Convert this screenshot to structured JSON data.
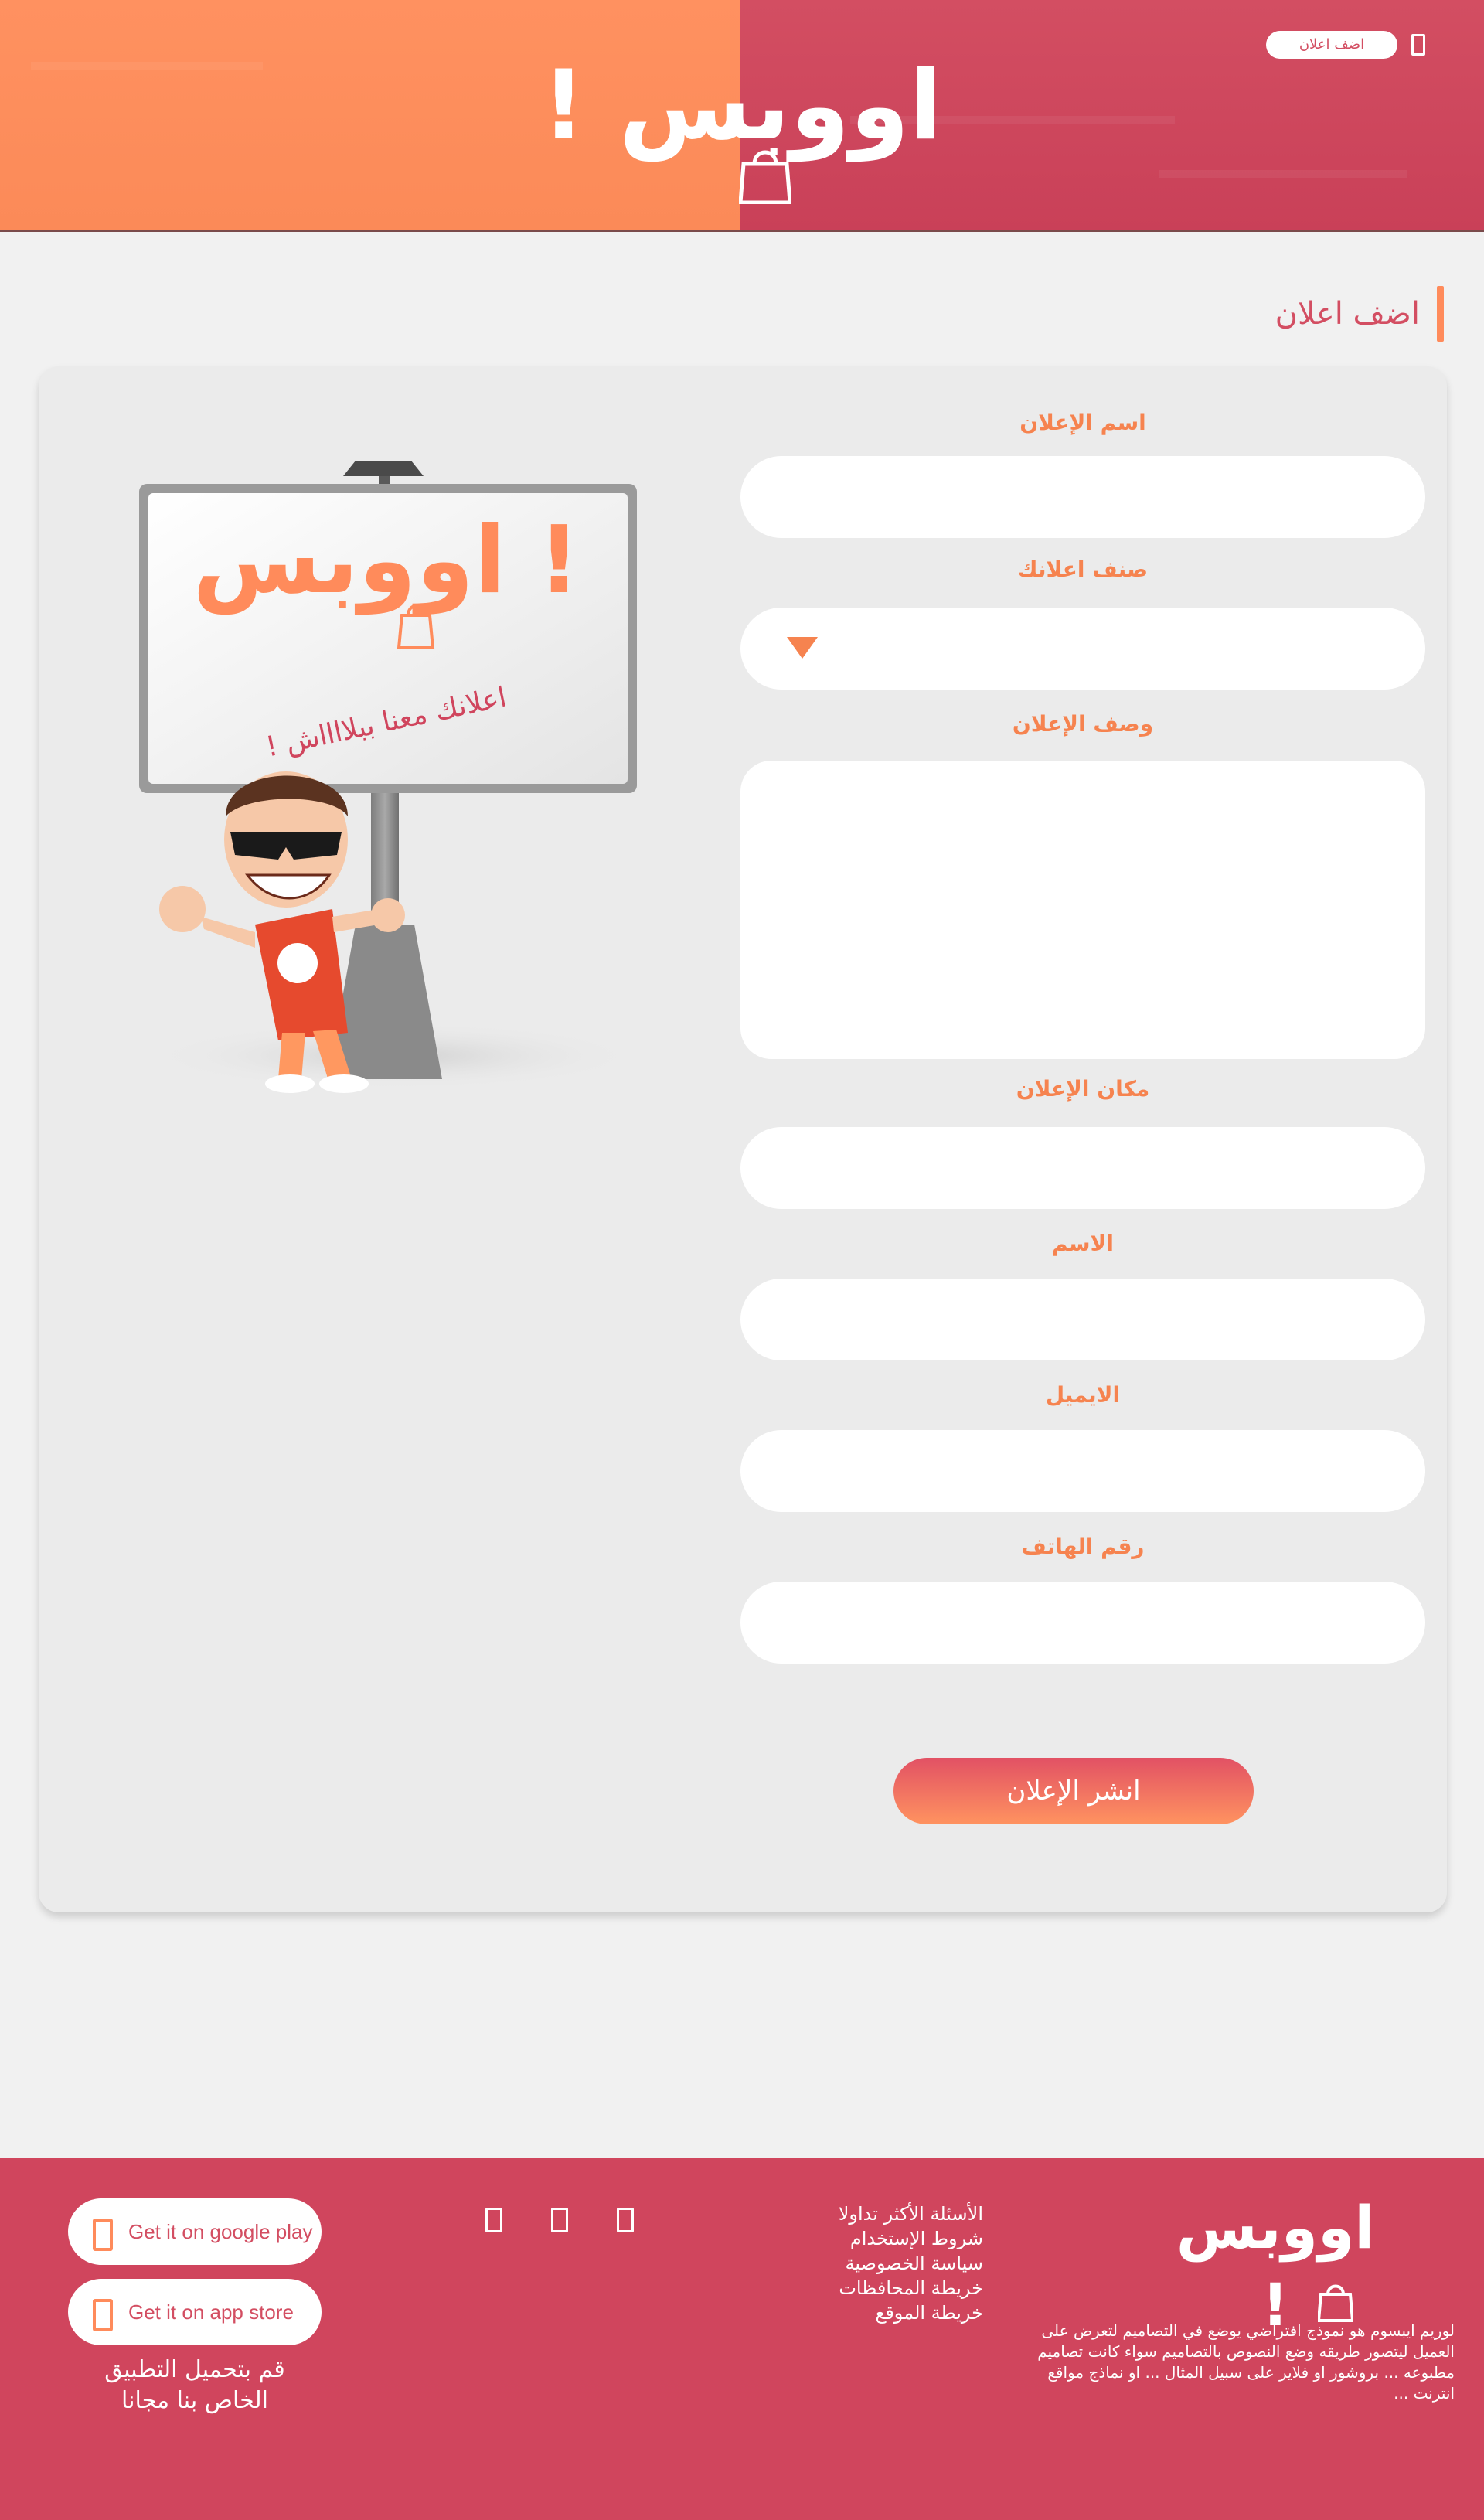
{
  "header": {
    "logo_text": "اووبس !",
    "add_ad_button": "اضف اعلان",
    "menu_icon": "menu-icon"
  },
  "page": {
    "title": "اضف اعلان"
  },
  "form": {
    "ad_name_label": "اسم الإعلان",
    "ad_name_value": "",
    "category_label": "صنف اعلانك",
    "category_selected": "",
    "description_label": "وصف الإعلان",
    "description_value": "",
    "location_label": "مكان الإعلان",
    "location_value": "",
    "name_label": "الاسم",
    "name_value": "",
    "email_label": "الايميل",
    "email_value": "",
    "phone_label": "رقم الهاتف",
    "phone_value": "",
    "submit_label": "انشر الإعلان"
  },
  "illustration": {
    "sign_logo": "اووبس !",
    "sign_tagline": "! اعلانك معنا ببلااااش"
  },
  "footer": {
    "logo_text": "اووبس !",
    "description": "لوريم ايبسوم هو نموذج افتراضي يوضع في التصاميم لتعرض على العميل ليتصور طريقه وضع النصوص بالتصاميم سواء كانت تصاميم مطبوعه ... بروشور او فلاير على سبيل المثال ... او نماذج مواقع انترنت ...",
    "links": [
      "الأسئلة الأكثر تداولا",
      "شروط الإستخدام",
      "سياسة الخصوصية",
      "خريطة المحافظات",
      "خريطة الموقع"
    ],
    "google_play_label": "Get it on google play",
    "app_store_label": "Get it on app store",
    "app_text_line1": "قم بتحميل التطبيق",
    "app_text_line2": "الخاص بنا مجانا"
  },
  "colors": {
    "orange": "#ff8b5b",
    "crimson": "#d0455d",
    "background": "#f1f1f1",
    "card": "#ebebeb"
  }
}
